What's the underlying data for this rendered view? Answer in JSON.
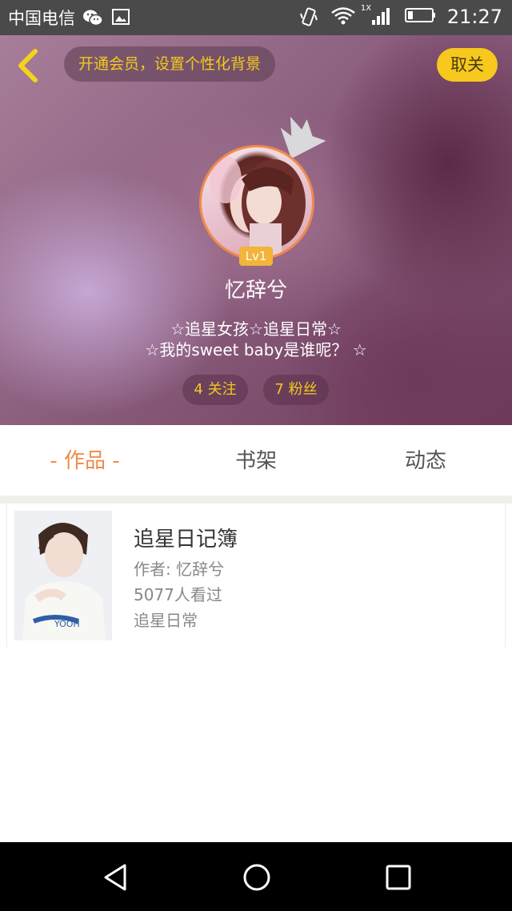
{
  "status_bar": {
    "carrier": "中国电信",
    "network_badge": "1X",
    "time": "21:27",
    "icons": [
      "wechat-icon",
      "gallery-icon",
      "vibrate-icon",
      "wifi-icon",
      "signal-icon",
      "battery-icon"
    ]
  },
  "header": {
    "vip_prompt": "开通会员，设置个性化背景",
    "unfollow_label": "取关",
    "level": "Lv1",
    "nickname": "忆辞兮",
    "bio_line1": "☆追星女孩☆追星日常☆",
    "bio_line2": "☆我的sweet baby是谁呢？ ☆",
    "following": "4 关注",
    "followers": "7 粉丝"
  },
  "tabs": {
    "works": "- 作品 -",
    "bookshelf": "书架",
    "activity": "动态"
  },
  "works": [
    {
      "title": "追星日记簿",
      "author": "作者: 忆辞兮",
      "views": "5077人看过",
      "tag": "追星日常",
      "cover_text": "YOOH"
    }
  ],
  "colors": {
    "accent_orange": "#f08a4b",
    "accent_yellow": "#f7c81d",
    "status_bar": "#4a4a4a"
  }
}
